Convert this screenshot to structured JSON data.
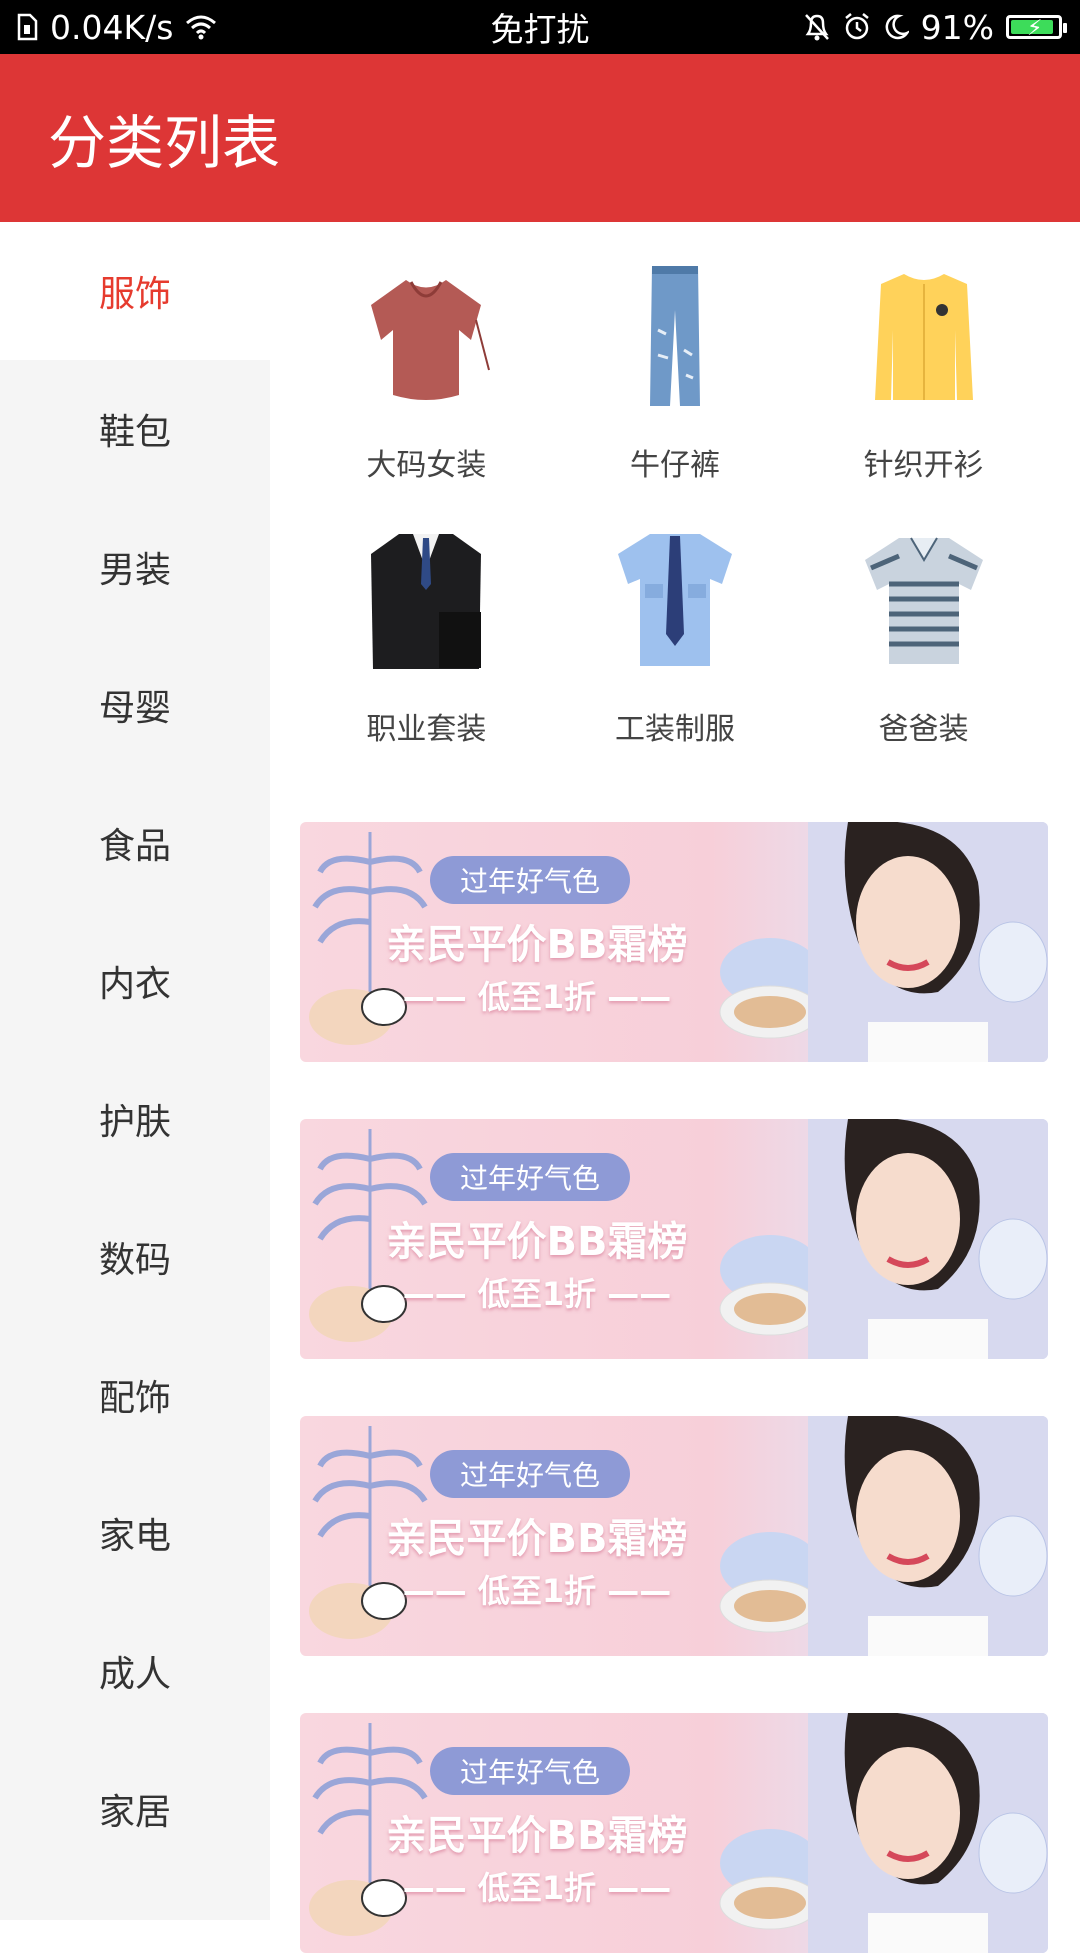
{
  "status_bar": {
    "network_speed": "0.04K/s",
    "mode": "免打扰",
    "battery": "91%",
    "battery_level": 0.91
  },
  "header": {
    "title": "分类列表",
    "color": "#dd3636"
  },
  "sidebar": {
    "active_color": "#e63b2e",
    "items": [
      {
        "label": "服饰",
        "active": true
      },
      {
        "label": "鞋包"
      },
      {
        "label": "男装"
      },
      {
        "label": "母婴"
      },
      {
        "label": "食品"
      },
      {
        "label": "内衣"
      },
      {
        "label": "护肤"
      },
      {
        "label": "数码"
      },
      {
        "label": "配饰"
      },
      {
        "label": "家电"
      },
      {
        "label": "成人"
      },
      {
        "label": "家居"
      }
    ]
  },
  "categories": [
    {
      "label": "大码女装",
      "icon": "blouse-icon"
    },
    {
      "label": "牛仔裤",
      "icon": "jeans-icon"
    },
    {
      "label": "针织开衫",
      "icon": "cardigan-icon"
    },
    {
      "label": "职业套装",
      "icon": "suit-icon"
    },
    {
      "label": "工装制服",
      "icon": "uniform-shirt-icon"
    },
    {
      "label": "爸爸装",
      "icon": "polo-shirt-icon"
    }
  ],
  "banner": {
    "pill": "过年好气色",
    "title": "亲民平价BB霜榜",
    "subtitle": "—— 低至1折 ——"
  }
}
